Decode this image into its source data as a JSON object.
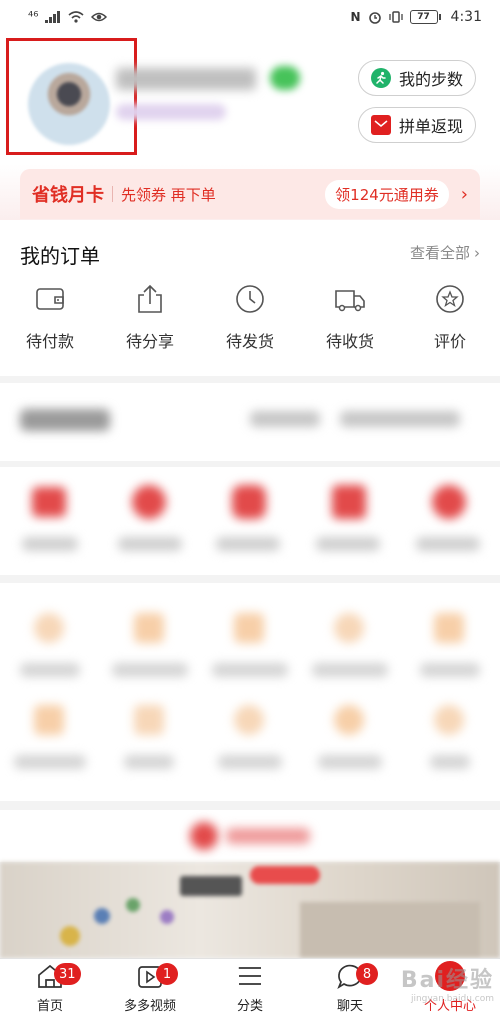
{
  "status_bar": {
    "network": "⁴⁶",
    "battery": "77",
    "time": "4:31"
  },
  "header": {
    "steps_button": "我的步数",
    "group_refund_button": "拼单返现"
  },
  "month_card": {
    "title": "省钱月卡",
    "subtitle": "先领券 再下单",
    "coupon": "领124元通用券",
    "arrow": "›"
  },
  "orders": {
    "title": "我的订单",
    "view_all": "查看全部",
    "view_all_arrow": "›",
    "items": [
      {
        "label": "待付款",
        "icon": "wallet-icon"
      },
      {
        "label": "待分享",
        "icon": "share-icon"
      },
      {
        "label": "待发货",
        "icon": "clock-icon"
      },
      {
        "label": "待收货",
        "icon": "truck-icon"
      },
      {
        "label": "评价",
        "icon": "star-icon"
      }
    ]
  },
  "tabbar": {
    "tabs": [
      {
        "label": "首页",
        "badge": "31",
        "icon": "home-icon"
      },
      {
        "label": "多多视频",
        "badge": "1",
        "icon": "video-icon"
      },
      {
        "label": "分类",
        "badge": "",
        "icon": "category-icon"
      },
      {
        "label": "聊天",
        "badge": "8",
        "icon": "chat-icon"
      },
      {
        "label": "个人中心",
        "badge": "",
        "icon": "profile-icon"
      }
    ],
    "active": "个人中心"
  },
  "watermark": {
    "main": "Bai经验",
    "sub": "jingyan.baidu.com"
  },
  "colors": {
    "accent": "#e02020",
    "highlight_box": "#d81c1c",
    "card_bg": "#fde8e6"
  }
}
